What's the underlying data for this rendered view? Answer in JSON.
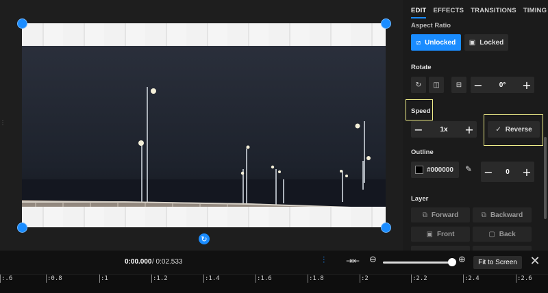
{
  "tabs": [
    {
      "label": "EDIT",
      "active": true
    },
    {
      "label": "EFFECTS",
      "active": false
    },
    {
      "label": "TRANSITIONS",
      "active": false
    },
    {
      "label": "TIMING",
      "active": false
    }
  ],
  "aspect_ratio": {
    "label": "Aspect Ratio",
    "unlocked_label": "Unlocked",
    "locked_label": "Locked",
    "selected": "Unlocked"
  },
  "rotate": {
    "label": "Rotate",
    "value": "0°"
  },
  "speed": {
    "label": "Speed",
    "value": "1x",
    "reverse_label": "Reverse",
    "reverse_checked": true
  },
  "outline": {
    "label": "Outline",
    "color_value": "#000000",
    "width_value": "0"
  },
  "layer": {
    "label": "Layer",
    "buttons": [
      "Forward",
      "Backward",
      "Front",
      "Back"
    ]
  },
  "toolbar": {
    "time_current": "0:00.000",
    "time_total": "/ 0:02.533",
    "fit_label": "Fit to Screen",
    "zoom_level": 0.95
  },
  "ruler": {
    "ticks": [
      ":.6",
      ":0.8",
      ":1",
      ":1.2",
      ":1.4",
      ":1.6",
      ":1.8",
      ":2",
      ":2.2",
      ":2.4",
      ":2.6"
    ]
  },
  "colors": {
    "accent": "#1a8cff",
    "highlight": "#f1ef8a"
  }
}
